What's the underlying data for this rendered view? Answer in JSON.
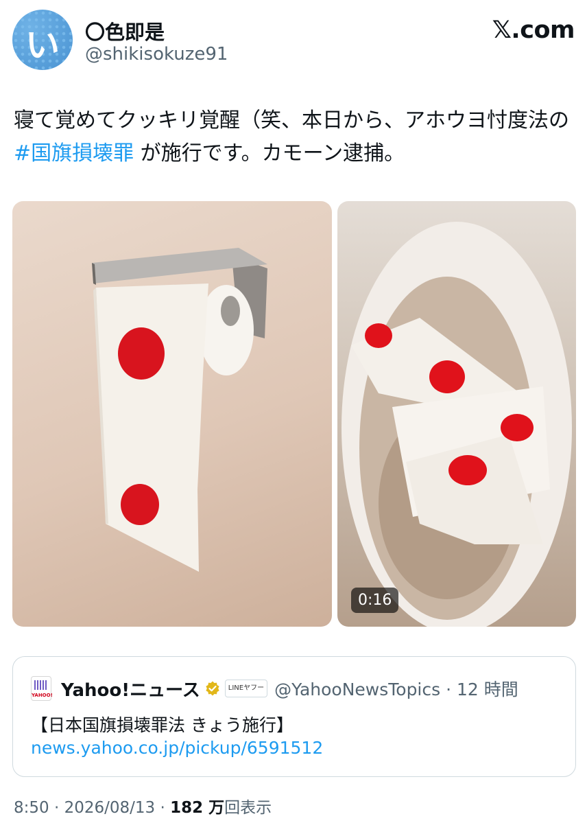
{
  "author": {
    "avatar_glyph": "い",
    "name": "〇色即是",
    "handle": "@shikisokuze91"
  },
  "brand": {
    "logo_text": "𝕏.com"
  },
  "tweet": {
    "text_before": "寝て覚めてクッキリ覚醒（笑、本日から、アホウヨ忖度法の ",
    "hashtag": "#国旗損壊罪",
    "text_after": " が施行です。カモーン逮捕。"
  },
  "media": {
    "video_duration": "0:16"
  },
  "quote": {
    "logo_label": "YAHOO!",
    "source_name": "Yahoo!ニュース",
    "line_badge": "LINEヤフー",
    "handle": "@YahooNewsTopics",
    "time": "12 時間",
    "title": "【日本国旗損壊罪法 きょう施行】",
    "link": "news.yahoo.co.jp/pickup/6591512"
  },
  "meta": {
    "time": "8:50",
    "date": "2026/08/13",
    "views_count": "182 万",
    "views_label": "回表示"
  },
  "colors": {
    "link": "#1d9bf0",
    "flag_red": "#e0121b"
  }
}
